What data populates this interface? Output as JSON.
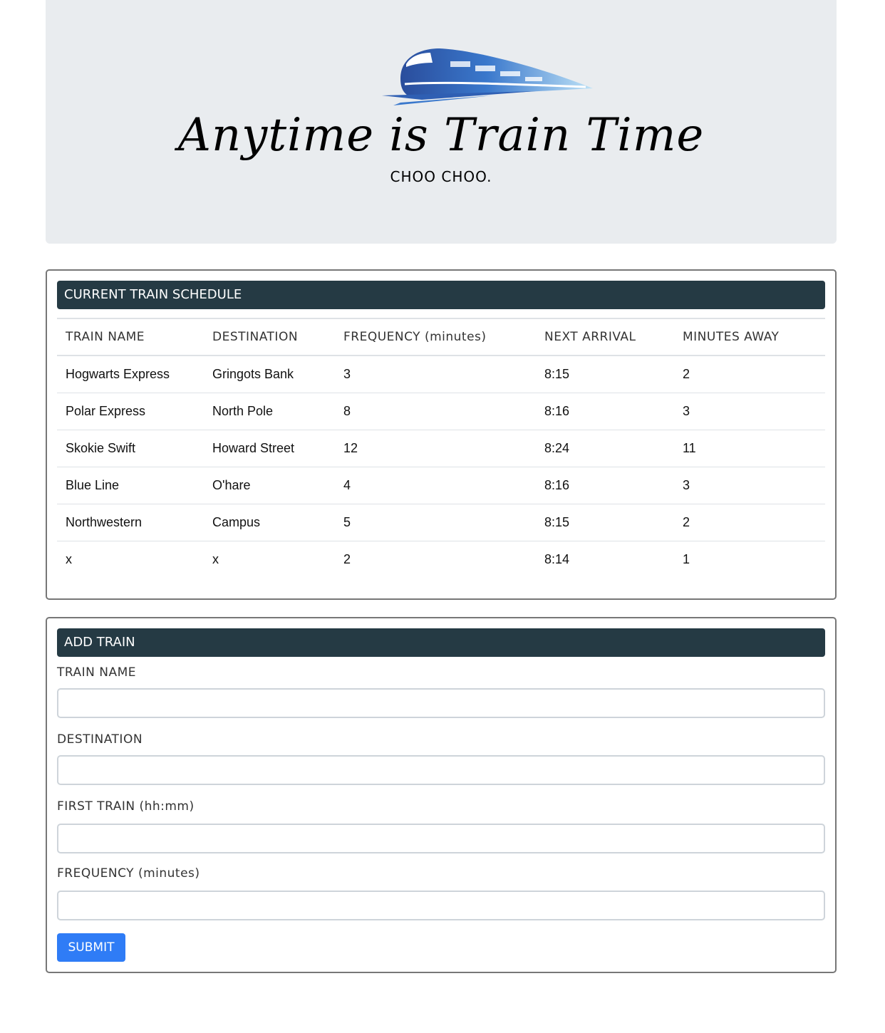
{
  "header": {
    "title": "Anytime is Train Time",
    "subtitle": "CHOO CHOO."
  },
  "schedule": {
    "heading": "CURRENT TRAIN SCHEDULE",
    "columns": [
      "TRAIN NAME",
      "DESTINATION",
      "FREQUENCY (minutes)",
      "NEXT ARRIVAL",
      "MINUTES AWAY"
    ],
    "rows": [
      [
        "Hogwarts Express",
        "Gringots Bank",
        "3",
        "8:15",
        "2"
      ],
      [
        "Polar Express",
        "North Pole",
        "8",
        "8:16",
        "3"
      ],
      [
        "Skokie Swift",
        "Howard Street",
        "12",
        "8:24",
        "11"
      ],
      [
        "Blue Line",
        "O'hare",
        "4",
        "8:16",
        "3"
      ],
      [
        "Northwestern",
        "Campus",
        "5",
        "8:15",
        "2"
      ],
      [
        "x",
        "x",
        "2",
        "8:14",
        "1"
      ]
    ]
  },
  "add_train": {
    "heading": "ADD TRAIN",
    "fields": [
      {
        "label": "TRAIN NAME",
        "value": ""
      },
      {
        "label": "DESTINATION",
        "value": ""
      },
      {
        "label": "FIRST TRAIN (hh:mm)",
        "value": ""
      },
      {
        "label": "FREQUENCY (minutes)",
        "value": ""
      }
    ],
    "submit_label": "SUBMIT"
  },
  "colors": {
    "jumbotron_bg": "#e9ecef",
    "card_header_bg": "#253a44",
    "submit_bg": "#2f7cf6",
    "logo_blue": "#2f5fb3"
  },
  "icons": {
    "logo": "bullet-train-icon"
  }
}
